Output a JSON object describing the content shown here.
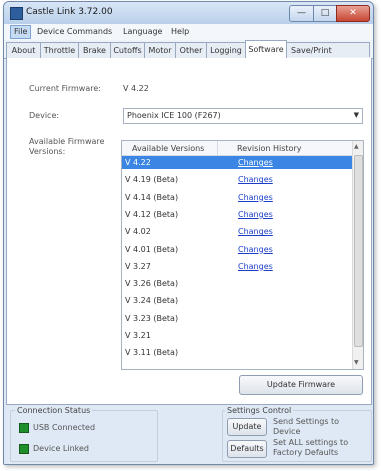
{
  "window": {
    "title": "Castle Link 3.72.00",
    "controls": {
      "minimize": "—",
      "maximize": "□",
      "close": "✕"
    }
  },
  "menu": [
    "File",
    "Device Commands",
    "Language",
    "Help"
  ],
  "tabs": [
    "About",
    "Throttle",
    "Brake",
    "Cutoffs",
    "Motor",
    "Other",
    "Logging",
    "Software",
    "Save/Print"
  ],
  "active_tab": "Software",
  "software": {
    "current_firmware_label": "Current Firmware:",
    "current_firmware_value": "V 4.22",
    "device_label": "Device:",
    "device_value": "Phoenix ICE 100 (F267)",
    "available_label_line1": "Available Firmware",
    "available_label_line2": "Versions:",
    "col_version": "Available Versions",
    "col_history": "Revision History",
    "versions": [
      {
        "version": "V 4.22",
        "notes": "Changes"
      },
      {
        "version": "V 4.19 (Beta)",
        "notes": "Changes"
      },
      {
        "version": "V 4.14 (Beta)",
        "notes": "Changes"
      },
      {
        "version": "V 4.12 (Beta)",
        "notes": "Changes"
      },
      {
        "version": "V 4.02",
        "notes": "Changes"
      },
      {
        "version": "V 4.01 (Beta)",
        "notes": "Changes"
      },
      {
        "version": "V 3.27",
        "notes": "Changes"
      },
      {
        "version": "V 3.26 (Beta)",
        "notes": ""
      },
      {
        "version": "V 3.24 (Beta)",
        "notes": ""
      },
      {
        "version": "V 3.23 (Beta)",
        "notes": ""
      },
      {
        "version": "V 3.21",
        "notes": ""
      },
      {
        "version": "V 3.11 (Beta)",
        "notes": ""
      }
    ],
    "selected_index": 0,
    "update_button": "Update Firmware"
  },
  "connection": {
    "title": "Connection Status",
    "usb": "USB Connected",
    "device": "Device Linked",
    "led_color": "#1e8f2a"
  },
  "settings_control": {
    "title": "Settings Control",
    "update_button": "Update",
    "update_desc": "Send Settings to Device",
    "defaults_button": "Defaults",
    "defaults_desc": "Set ALL settings to Factory Defaults"
  }
}
